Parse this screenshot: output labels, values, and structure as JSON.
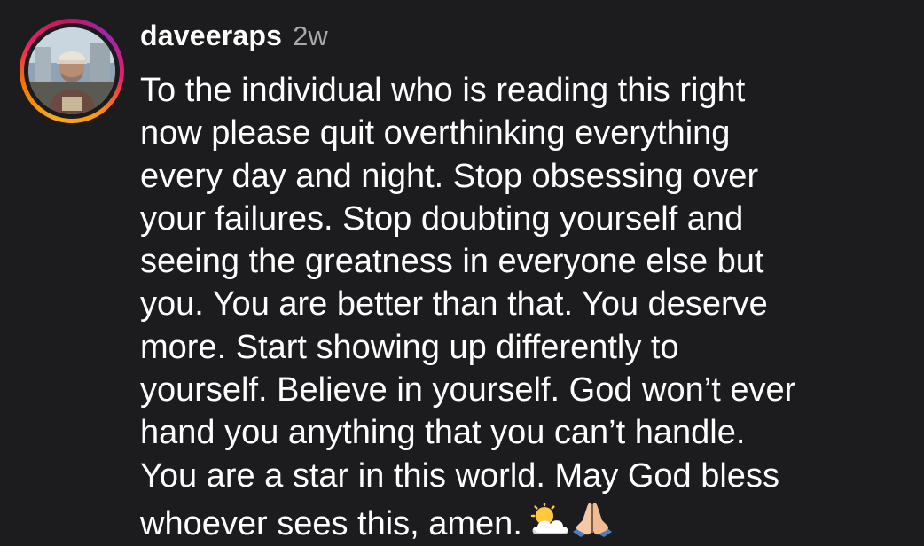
{
  "post": {
    "author": {
      "username": "daveeraps",
      "timestamp": "2w"
    },
    "caption_lines": [
      "To the individual who is reading this right",
      "now please quit overthinking everything",
      "every day and night. Stop obsessing over",
      "your failures. Stop doubting yourself and",
      "seeing the greatness in everyone else but",
      "you. You are better than that. You deserve",
      "more. Start showing up differently to",
      "yourself. Believe in yourself. God won’t ever",
      "hand you anything that you can’t handle.",
      "You are a star in this world. May God bless",
      "whoever sees this, amen."
    ],
    "emojis": [
      "sun-behind-cloud-icon",
      "folded-hands-icon"
    ]
  },
  "colors": {
    "background": "#1c1c1e",
    "text": "#ffffff",
    "timestamp": "#a8a8ad",
    "story_ring": [
      "#f9a825",
      "#e91e63",
      "#9c27b0"
    ]
  }
}
